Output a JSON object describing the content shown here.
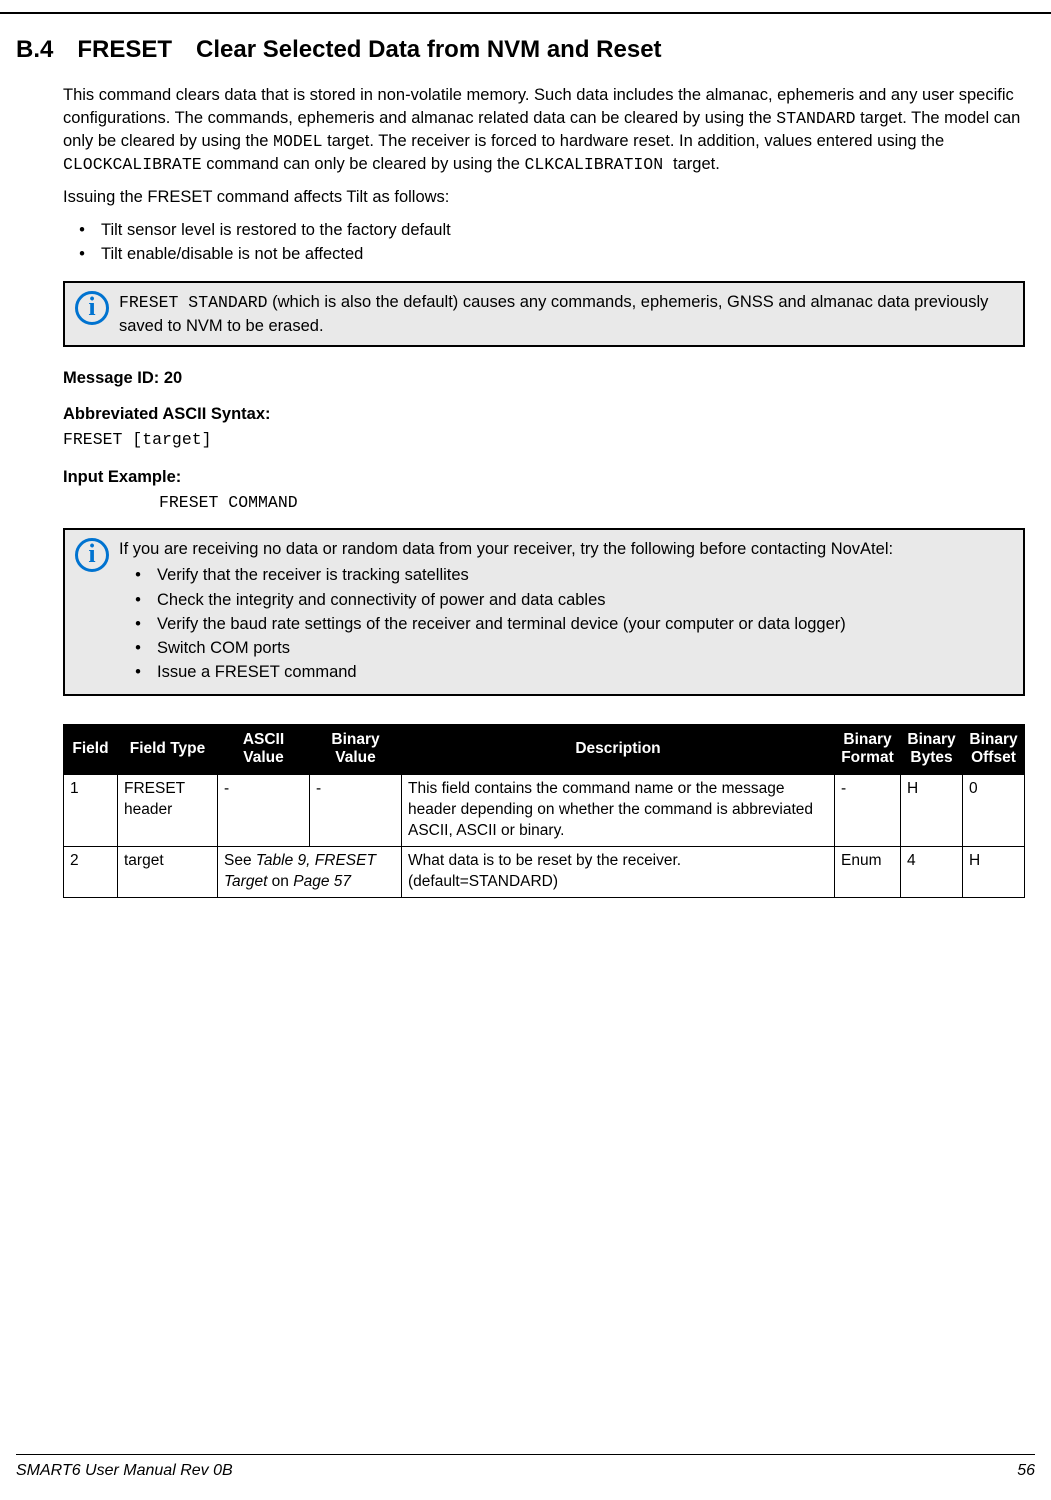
{
  "heading": {
    "num": "B.4",
    "cmd": "FRESET",
    "title": "Clear Selected Data from NVM and Reset"
  },
  "intro": {
    "p1a": "This command clears data that is stored in non-volatile memory. Such data includes the almanac, ephemeris and any user specific configurations. The commands, ephemeris and almanac related data can be cleared by using the ",
    "p1_code1": "STANDARD",
    "p1b": " target. The model can only be cleared by using the ",
    "p1_code2": "MODEL",
    "p1c": " target. The receiver is forced to hardware reset. In addition, values entered using the ",
    "p1_code3": "CLOCKCALIBRATE",
    "p1d": " command can only be cleared by using the ",
    "p1_code4": "CLKCALIBRATION ",
    "p1e": " target.",
    "p2": "Issuing the FRESET command affects Tilt as follows:",
    "bullets": [
      "Tilt sensor level is restored to the factory default",
      "Tilt enable/disable is not be affected"
    ]
  },
  "info1": {
    "code": "FRESET STANDARD",
    "rest": " (which is also the default) causes any commands, ephemeris, GNSS and almanac data previously saved to NVM to be erased."
  },
  "msgid": {
    "label": "Message ID: 20"
  },
  "syntax": {
    "label": "Abbreviated ASCII Syntax:",
    "value": "FRESET [target]"
  },
  "example": {
    "label": "Input Example:",
    "value": "FRESET COMMAND"
  },
  "info2": {
    "lead": "If you are receiving no data or random data from your receiver, try the following before contacting NovAtel:",
    "bullets": [
      "Verify that the receiver is tracking satellites",
      "Check the integrity and connectivity of power and data cables",
      "Verify the baud rate settings of the receiver and terminal device (your computer or data logger)",
      "Switch COM ports",
      "Issue a FRESET command"
    ]
  },
  "table": {
    "headers": {
      "field": "Field",
      "field_type": "Field Type",
      "ascii_value": "ASCII Value",
      "binary_value": "Binary Value",
      "description": "Description",
      "binary_format": "Binary Format",
      "binary_bytes": "Binary Bytes",
      "binary_offset": "Binary Offset"
    },
    "rows": [
      {
        "field": "1",
        "field_type": "FRESET header",
        "ascii_value": "-",
        "binary_value": "-",
        "description": "This field contains the command name or the message header depending on whether the command is abbreviated ASCII, ASCII or binary.",
        "binary_format": "-",
        "binary_bytes": "H",
        "binary_offset": "0"
      },
      {
        "field": "2",
        "field_type": "target",
        "combined_a": "See ",
        "combined_i": "Table 9, FRESET Target",
        "combined_b": " on ",
        "combined_i2": "Page 57",
        "description": "What data is to be reset by the receiver. (default=STANDARD)",
        "binary_format": "Enum",
        "binary_bytes": "4",
        "binary_offset": "H"
      }
    ]
  },
  "footer": {
    "left": "SMART6 User Manual Rev 0B",
    "right": "56"
  }
}
